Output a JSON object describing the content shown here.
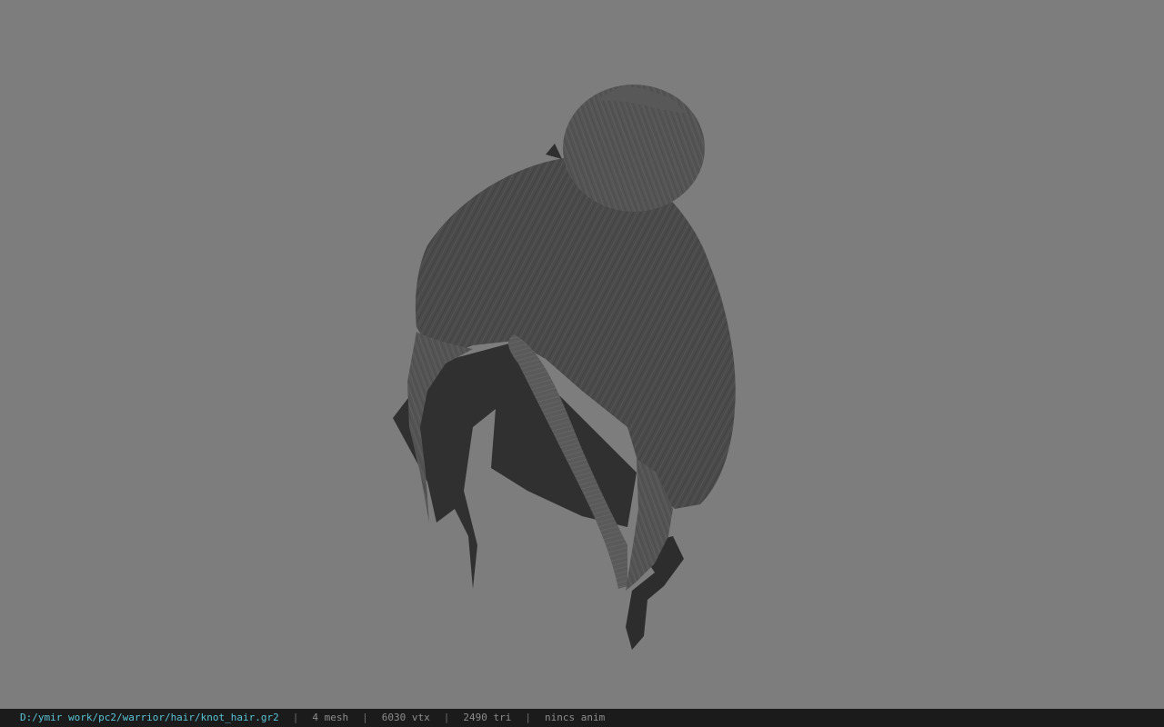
{
  "viewport": {
    "background_color": "#7d7d7d",
    "model_name": "knot_hair"
  },
  "statusbar": {
    "file_path": "D:/ymir work/pc2/warrior/hair/knot_hair.gr2",
    "separator": "|",
    "mesh_count": "4 mesh",
    "vertex_count": "6030 vtx",
    "triangle_count": "2490 tri",
    "anim_info": "nincs anim",
    "path_color": "#59c1d2",
    "text_color": "#8c8c8c",
    "background_color": "#1b1b1b"
  }
}
